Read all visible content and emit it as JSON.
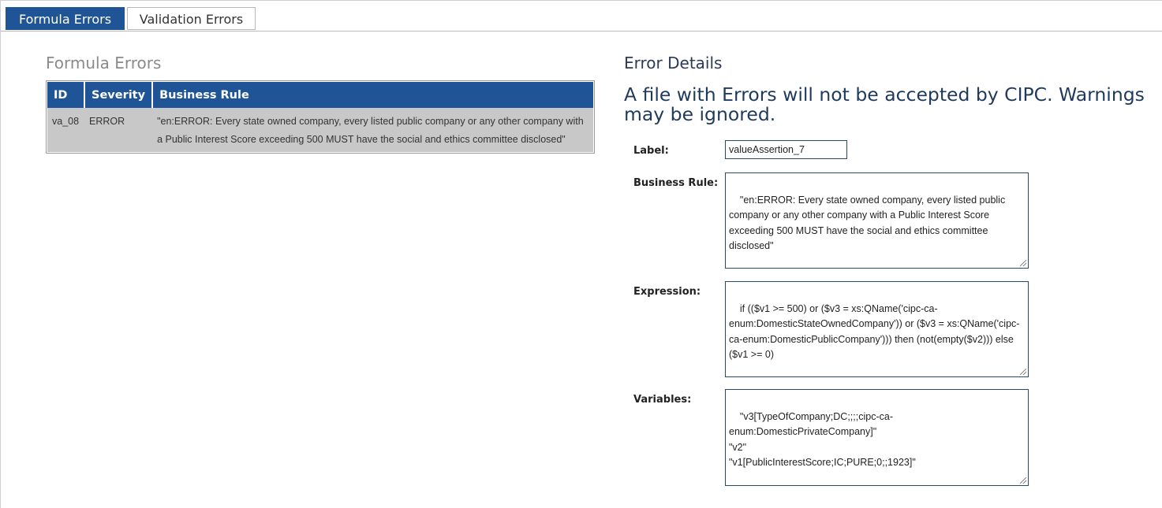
{
  "tabs": [
    {
      "label": "Formula Errors",
      "active": true
    },
    {
      "label": "Validation Errors",
      "active": false
    }
  ],
  "left": {
    "title": "Formula Errors",
    "columns": [
      "ID",
      "Severity",
      "Business Rule"
    ],
    "rows": [
      {
        "id": "va_08",
        "severity": "ERROR",
        "rule": "\"en:ERROR: Every state owned company, every listed public company or any other company with a Public Interest Score exceeding 500 MUST have the social and ethics committee disclosed\""
      }
    ]
  },
  "details": {
    "title": "Error Details",
    "warning": "A file with Errors will not be accepted by CIPC. Warnings may be ignored.",
    "label_caption": "Label:",
    "label_value": "valueAssertion_7",
    "business_rule_caption": "Business Rule:",
    "business_rule_value": "\"en:ERROR: Every state owned company, every listed public company or any other company with a Public Interest Score exceeding 500 MUST have the social and ethics committee disclosed\"",
    "expression_caption": "Expression:",
    "expression_value": "if (($v1 >= 500) or ($v3 = xs:QName('cipc-ca-enum:DomesticStateOwnedCompany')) or ($v3 = xs:QName('cipc-ca-enum:DomesticPublicCompany'))) then (not(empty($v2))) else ($v1 >= 0)",
    "variables_caption": "Variables:",
    "variables_value": "\"v3[TypeOfCompany;DC;;;;cipc-ca-enum:DomesticPrivateCompany]\"\n\"v2\"\n\"v1[PublicInterestScore;IC;PURE;0;;1923]\""
  },
  "colors": {
    "accent": "#1f5596",
    "row_bg": "#c8c8c8",
    "heading": "#1f3a5c"
  }
}
